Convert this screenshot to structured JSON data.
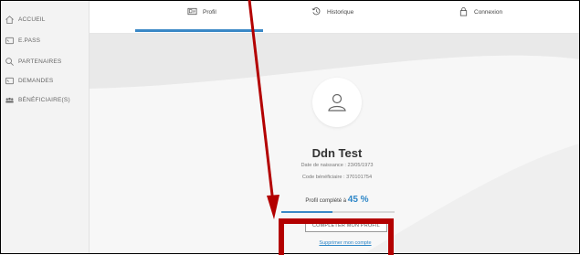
{
  "sidebar": {
    "items": [
      {
        "label": "ACCUEIL",
        "icon": "home-icon"
      },
      {
        "label": "E.PASS",
        "icon": "pass-icon"
      },
      {
        "label": "PARTENAIRES",
        "icon": "search-icon"
      },
      {
        "label": "DEMANDES",
        "icon": "document-icon"
      },
      {
        "label": "BÉNÉFICIAIRE(S)",
        "icon": "group-icon"
      }
    ]
  },
  "tabs": [
    {
      "label": "Profil",
      "icon": "id-card-icon",
      "active": true
    },
    {
      "label": "Historique",
      "icon": "history-icon",
      "active": false
    },
    {
      "label": "Connexion",
      "icon": "lock-icon",
      "active": false
    }
  ],
  "profile": {
    "name": "Ddn Test",
    "birth_date": "Date de naissance : 23/05/1973",
    "beneficiary_code": "Code bénéficiaire : 370101754",
    "completion_prefix": "Profil complété à",
    "completion_percent": "45 %",
    "completion_value": 0.45,
    "complete_button": "COMPLÉTER MON PROFIL",
    "delete_link": "Supprimer mon compte"
  },
  "colors": {
    "accent": "#3a88c6",
    "annotation": "#b30000"
  }
}
